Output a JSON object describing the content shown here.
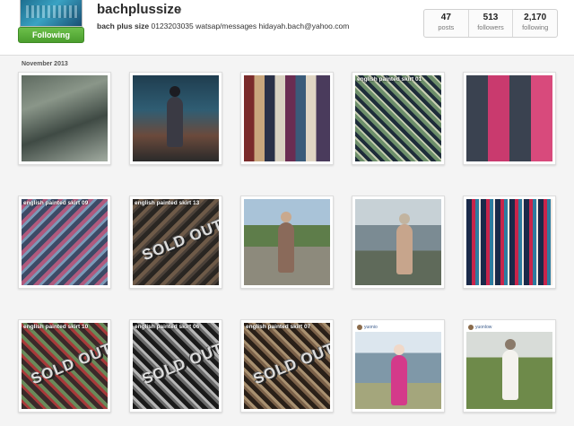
{
  "profile": {
    "username": "bachplussize",
    "follow_label": "Following",
    "bio_name": "bach plus size",
    "bio_text": "0123203035 watsap/messages hidayah.bach@yahoo.com"
  },
  "stats": [
    {
      "value": "47",
      "label": "posts"
    },
    {
      "value": "513",
      "label": "followers"
    },
    {
      "value": "2,170",
      "label": "following"
    }
  ],
  "section": {
    "month": "November 2013"
  },
  "photos": [
    {
      "caption": "",
      "sold": "",
      "theme": "bags"
    },
    {
      "caption": "",
      "sold": "",
      "theme": "mirror-selfie"
    },
    {
      "caption": "",
      "sold": "",
      "theme": "colored-fabrics"
    },
    {
      "caption": "english painted skirt 01",
      "sold": "",
      "theme": "skirt-green"
    },
    {
      "caption": "",
      "sold": "",
      "theme": "pink-collage"
    },
    {
      "caption": "english painted skirt 09",
      "sold": "",
      "theme": "skirt-pink"
    },
    {
      "caption": "english painted skirt 13",
      "sold": "SOLD OUT",
      "theme": "skirt-dark"
    },
    {
      "caption": "",
      "sold": "",
      "theme": "outdoor-woman"
    },
    {
      "caption": "",
      "sold": "",
      "theme": "car-woman"
    },
    {
      "caption": "",
      "sold": "",
      "theme": "rack-skirts"
    },
    {
      "caption": "english painted skirt 10",
      "sold": "SOLD OUT",
      "theme": "skirt-red"
    },
    {
      "caption": "english painted skirt 06",
      "sold": "SOLD OUT",
      "theme": "skirt-mono"
    },
    {
      "caption": "english painted skirt 07",
      "sold": "SOLD OUT",
      "theme": "skirt-sepia"
    },
    {
      "caption": "",
      "sold": "",
      "theme": "pink-woman",
      "ig_user": "yuonio"
    },
    {
      "caption": "",
      "sold": "",
      "theme": "field-woman",
      "ig_user": "yuonlow"
    }
  ],
  "colors": {
    "follow_green": "#5aae3a",
    "accent_link": "#3a5a8a"
  }
}
